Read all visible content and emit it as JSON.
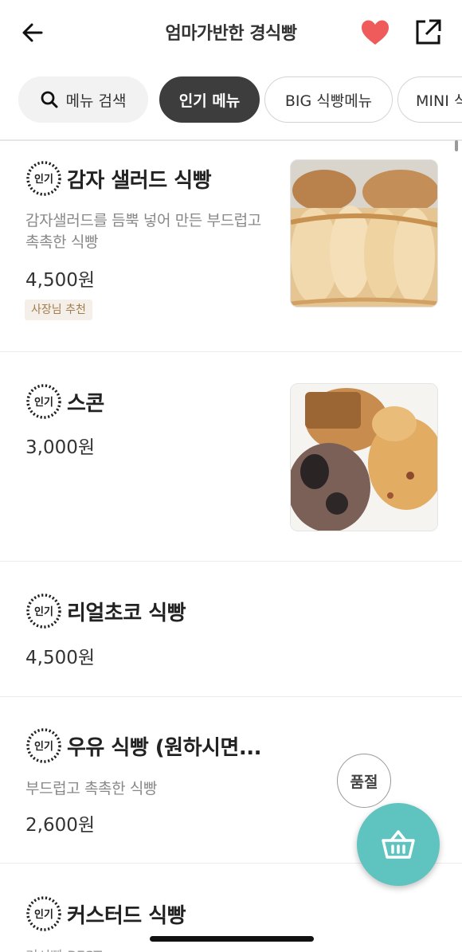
{
  "header": {
    "title": "엄마가반한 경식빵",
    "heart_color": "#ef5a5a"
  },
  "tabs": {
    "search_label": "메뉴 검색",
    "items": [
      "인기 메뉴",
      "BIG 식빵메뉴",
      "MINI 식빵"
    ]
  },
  "badge_label": "인기",
  "menu": [
    {
      "name": "감자 샐러드 식빵",
      "desc_line1": "감자샐러드를 듬뿍 넣어 만든 부드럽고",
      "desc_line2": "촉촉한 식빵",
      "price": "4,500원",
      "tag": "사장님 추천",
      "image": "potato-bread-photo"
    },
    {
      "name": "스콘",
      "price": "3,000원",
      "image": "scone-photo"
    },
    {
      "name": "리얼초코 식빵",
      "price": "4,500원"
    },
    {
      "name": "우유 식빵 (원하시면...",
      "desc_line1": "부드럽고 촉촉한 식빵",
      "price": "2,600원",
      "status": "품절"
    },
    {
      "name": "커스터드 식빵",
      "desc_partial": "커시빵 BEST"
    }
  ],
  "colors": {
    "accent": "#5fc3bf",
    "active_tab": "#3d3d3d",
    "tag_bg": "#f4efe9",
    "tag_text": "#a27c4d"
  }
}
